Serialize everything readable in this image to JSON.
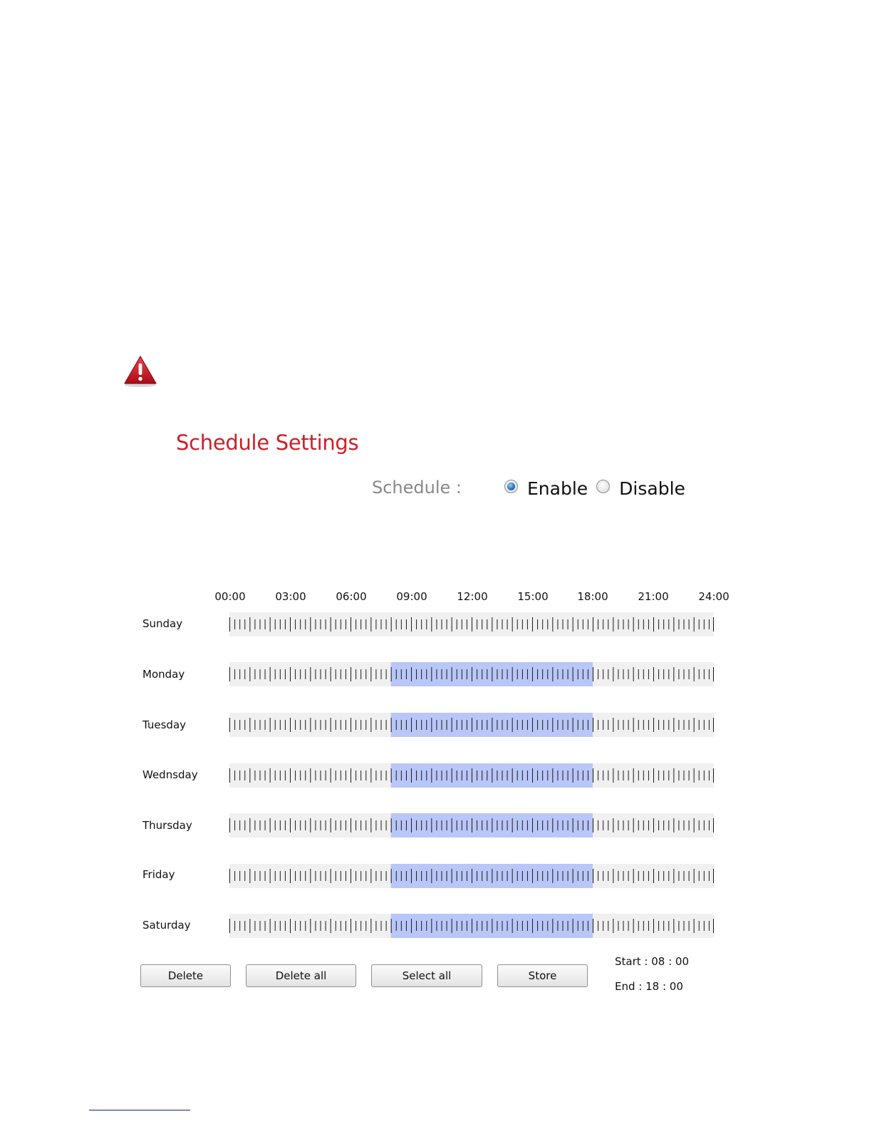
{
  "title": "Schedule Settings",
  "schedule": {
    "label": "Schedule :",
    "options": [
      "Enable",
      "Disable"
    ],
    "selected": "Enable"
  },
  "time_axis": [
    "00:00",
    "03:00",
    "06:00",
    "09:00",
    "12:00",
    "15:00",
    "18:00",
    "21:00",
    "24:00"
  ],
  "days": [
    {
      "name": "Sunday",
      "selected_start_hour": null,
      "selected_end_hour": null
    },
    {
      "name": "Monday",
      "selected_start_hour": 8,
      "selected_end_hour": 18
    },
    {
      "name": "Tuesday",
      "selected_start_hour": 8,
      "selected_end_hour": 18
    },
    {
      "name": "Wednsday",
      "selected_start_hour": 8,
      "selected_end_hour": 18
    },
    {
      "name": "Thursday",
      "selected_start_hour": 8,
      "selected_end_hour": 18
    },
    {
      "name": "Friday",
      "selected_start_hour": 8,
      "selected_end_hour": 18
    },
    {
      "name": "Saturday",
      "selected_start_hour": 8,
      "selected_end_hour": 18
    }
  ],
  "buttons": {
    "delete": "Delete",
    "delete_all": "Delete all",
    "select_all": "Select all",
    "store": "Store"
  },
  "range": {
    "start": "Start : 08 : 00",
    "end": "End : 18 : 00"
  },
  "colors": {
    "title": "#cc1f2a",
    "selection": "#b9c6f8",
    "track": "#f0f0f0",
    "warning": "#c8101e"
  },
  "icons": {
    "warning": "warning-triangle-icon"
  }
}
